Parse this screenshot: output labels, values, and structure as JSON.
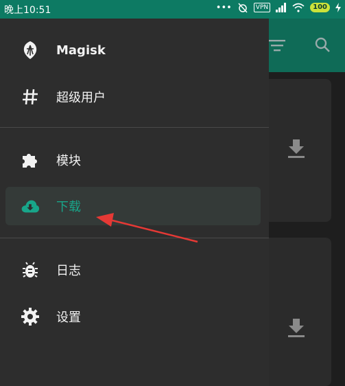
{
  "status_bar": {
    "time": "晚上10:51",
    "vpn": "VPN",
    "battery": "100"
  },
  "drawer": {
    "header": {
      "title": "Magisk",
      "icon": "magisk-logo-icon"
    },
    "items": [
      {
        "label": "超级用户",
        "icon": "hash-icon"
      },
      {
        "label": "模块",
        "icon": "puzzle-icon"
      },
      {
        "label": "下载",
        "icon": "cloud-download-icon",
        "active": true
      },
      {
        "label": "日志",
        "icon": "bug-icon"
      },
      {
        "label": "设置",
        "icon": "gear-icon"
      }
    ]
  },
  "colors": {
    "accent": "#18a68a",
    "status_bar": "#0d7a63",
    "annotation": "#e53935"
  }
}
